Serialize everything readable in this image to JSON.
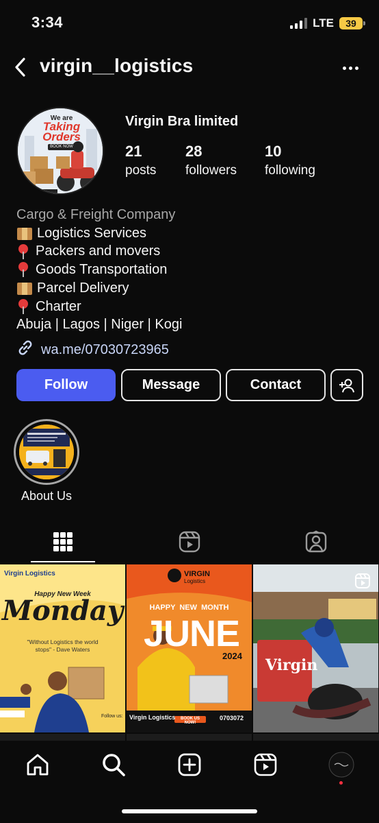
{
  "status_bar": {
    "time": "3:34",
    "network": "LTE",
    "battery": "39"
  },
  "header": {
    "username": "virgin__logistics",
    "back_icon": "chevron-left-icon",
    "more_icon": "more-horizontal-icon"
  },
  "profile": {
    "display_name": "Virgin Bra limited",
    "avatar_text": {
      "line1": "We are",
      "line2": "Taking",
      "line3": "Orders",
      "button": "BOOK NOW"
    },
    "stats": [
      {
        "value": "21",
        "label": "posts"
      },
      {
        "value": "28",
        "label": "followers"
      },
      {
        "value": "10",
        "label": "following"
      }
    ]
  },
  "bio": {
    "category": "Cargo & Freight Company",
    "lines": [
      {
        "icon": "package-icon",
        "text": "Logistics Services"
      },
      {
        "icon": "pin-icon",
        "text": "Packers and movers"
      },
      {
        "icon": "pin-icon",
        "text": "Goods Transportation"
      },
      {
        "icon": "package-icon",
        "text": "Parcel Delivery"
      },
      {
        "icon": "pin-icon",
        "text": "Charter"
      }
    ],
    "cities": "Abuja | Lagos | Niger | Kogi",
    "link": "wa.me/07030723965"
  },
  "actions": {
    "follow": "Follow",
    "message": "Message",
    "contact": "Contact"
  },
  "highlights": [
    {
      "label": "About Us"
    }
  ],
  "tabs": [
    "grid-icon",
    "reels-icon",
    "tagged-icon"
  ],
  "posts": [
    {
      "brand": "Virgin Logistics",
      "kicker": "Happy New Week",
      "title": "Monday",
      "quote": "\"Without Logistics the world stops\" - Dave Waters",
      "contact": "Follow us:"
    },
    {
      "brand": "VIRGIN",
      "sub": "Logistics",
      "kicker": "HAPPY  NEW  MONTH",
      "title": "JUNE",
      "year": "2024",
      "footer": "Virgin Logistics",
      "cta": "BOOK US NOW!",
      "phone": "0703072"
    },
    {
      "sign": "Virgin"
    }
  ],
  "bottom_nav": [
    "home-icon",
    "search-icon",
    "create-icon",
    "reels-icon",
    "profile-avatar"
  ]
}
